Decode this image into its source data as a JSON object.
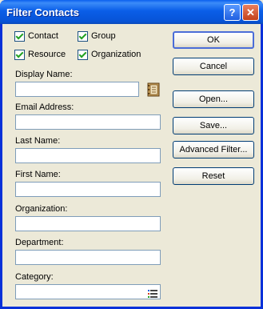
{
  "window": {
    "title": "Filter Contacts"
  },
  "titlebar": {
    "help": "?",
    "close": "✕"
  },
  "checkboxes": {
    "contact": "Contact",
    "group": "Group",
    "resource": "Resource",
    "organization": "Organization"
  },
  "fields": {
    "display_name": "Display Name:",
    "email": "Email Address:",
    "last_name": "Last Name:",
    "first_name": "First Name:",
    "organization": "Organization:",
    "department": "Department:",
    "category": "Category:"
  },
  "buttons": {
    "ok": "OK",
    "cancel": "Cancel",
    "open": "Open...",
    "save": "Save...",
    "advanced": "Advanced Filter...",
    "reset": "Reset"
  }
}
